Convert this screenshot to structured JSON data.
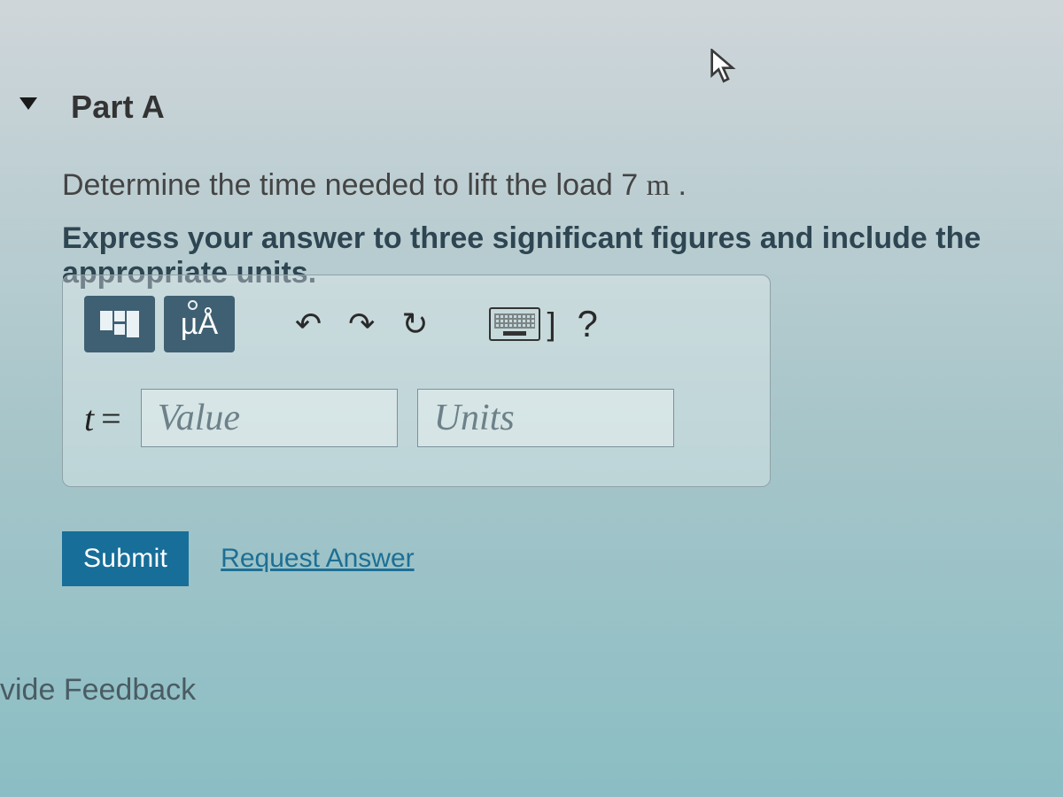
{
  "part_title": "Part A",
  "prompt_line1_pre": "Determine the time needed to lift the load 7 ",
  "prompt_line1_unit": "m",
  "prompt_line1_post": " .",
  "prompt_line2": "Express your answer to three significant figures and include the appropriate units.",
  "toolbar": {
    "mu_label": "µÅ",
    "help_label": "?"
  },
  "answer": {
    "var_label": "t",
    "equals": "=",
    "value_placeholder": "Value",
    "units_placeholder": "Units"
  },
  "submit_label": "Submit",
  "request_answer_label": "Request Answer",
  "feedback_fragment": "vide Feedback"
}
